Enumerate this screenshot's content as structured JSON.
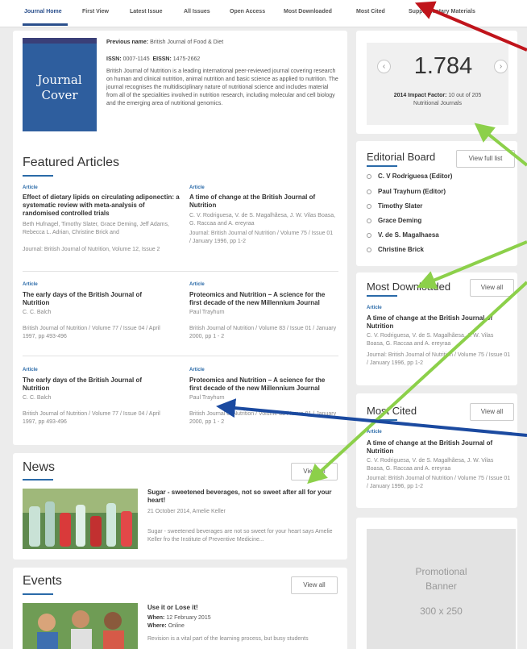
{
  "nav": {
    "tabs": [
      "Journal Home",
      "First View",
      "Latest Issue",
      "All Issues",
      "Open Access",
      "Most Downloaded",
      "Most Cited",
      "Supplementary Materials"
    ]
  },
  "journal": {
    "cover_text": "Journal Cover",
    "previous_name_label": "Previous name:",
    "previous_name": "British Journal of Food & Diet",
    "issn_label": "ISSN:",
    "issn": "0007-1145",
    "eissn_label": "EISSN:",
    "eissn": "1475-2662",
    "description": "British Journal of Nutrition is a leading international peer-reviewed journal covering research on human and clinical nutrition, animal nutrition and basic science as applied to nutrition. The journal recognises the multidisciplinary nature of nutritional science and includes material from all of the specialities involved in nutrition research, including molecular and cell biology and the emerging area of nutritional genomics."
  },
  "featured": {
    "heading": "Featured Articles",
    "articles": [
      {
        "label": "Article",
        "title": "Effect of dietary lipids on circulating adiponectin: a systematic review with meta-analysis of randomised controlled trials",
        "authors": "Beth Hufnagel, Timothy Slater, Grace Deming, Jeff Adams, Rebecca L. Adrian, Christine Brick and",
        "journal": "Journal: British Journal of Nutrition, Volume 12, Issue 2"
      },
      {
        "label": "Article",
        "title": "A time of change at the British Journal of Nutrition",
        "authors": "C. V. Rodriguesa, V. de S. Magalhãesa, J. W. Vilas Boasa, G. Raccaa and A. ereyraa",
        "journal": "Journal: British Journal of Nutrition / Volume 75 / Issue 01 / January 1996, pp 1-2"
      },
      {
        "label": "Article",
        "title": "The early days of the British Journal of Nutrition",
        "authors": "C. C. Balch",
        "journal": "British Journal of Nutrition / Volume 77 / Issue 04 / April 1997, pp 493-496"
      },
      {
        "label": "Article",
        "title": "Proteomics and Nutrition – A science for the first decade of the new Millennium Journal",
        "authors": "Paul Trayhurn",
        "journal": "British Journal of Nutrition / Volume 83 / Issue 01 / January 2000, pp 1 - 2"
      },
      {
        "label": "Article",
        "title": "The early days of the British Journal of Nutrition",
        "authors": "C. C. Balch",
        "journal": "British Journal of Nutrition / Volume 77 / Issue 04 / April 1997, pp 493-496"
      },
      {
        "label": "Article",
        "title": "Proteomics and Nutrition – A science for the first decade of the new Millennium Journal",
        "authors": "Paul Trayhurn",
        "journal": "British Journal of Nutrition / Volume 83 / Issue 01 / January 2000, pp 1 - 2"
      }
    ]
  },
  "news": {
    "heading": "News",
    "view_all": "View all",
    "title": "Sugar - sweetened beverages, not so sweet after all for your heart!",
    "meta": "21 October 2014, Amelie Keller",
    "summary": "Sugar - sweetened beverages are not so sweet for your heart says Amelie Keller fro the Institute of Preventive Medicine..."
  },
  "events": {
    "heading": "Events",
    "view_all": "View all",
    "title": "Use it or Lose it!",
    "when_label": "When:",
    "when": "12 February 2015",
    "where_label": "Where:",
    "where": "Online",
    "summary": "Revision is a vital part of the learning process, but busy students"
  },
  "impact": {
    "value": "1.784",
    "label": "2014 Impact Factor:",
    "rank": "10 out of 205",
    "category": "Nutritional Journals"
  },
  "board": {
    "heading": "Editorial Board",
    "view_all": "View full list",
    "members": [
      "C. V Rodriguesa (Editor)",
      "Paul Trayhurn (Editor)",
      "Timothy Slater",
      "Grace Deming",
      "V. de S. Magalhaesa",
      "Christine Brick"
    ]
  },
  "most_downloaded": {
    "heading": "Most Downloaded",
    "view_all": "View all",
    "label": "Article",
    "title": "A time of change at the British Journal of Nutrition",
    "authors": "C. V. Rodriguesa, V. de S. Magalhãesa, J. W. Vilas Boasa, G. Raccaa and A. ereyraa",
    "journal": "Journal: British Journal of Nutrition / Volume 75 / Issue 01 / January 1996, pp 1-2"
  },
  "most_cited": {
    "heading": "Most Cited",
    "view_all": "View all",
    "label": "Article",
    "title": "A time of change at the British Journal of Nutrition",
    "authors": "C. V. Rodriguesa, V. de S. Magalhãesa, J. W. Vilas Boasa, G. Raccaa and A. ereyraa",
    "journal": "Journal: British Journal of Nutrition / Volume 75 / Issue 01 / January 1996, pp 1-2"
  },
  "promo": {
    "line1": "Promotional",
    "line2": "Banner",
    "size": "300 x 250"
  },
  "colors": {
    "accent": "#2a4f8c",
    "arrow_red": "#c0141b",
    "arrow_green": "#8cd04a",
    "arrow_blue": "#1b4aa0"
  }
}
